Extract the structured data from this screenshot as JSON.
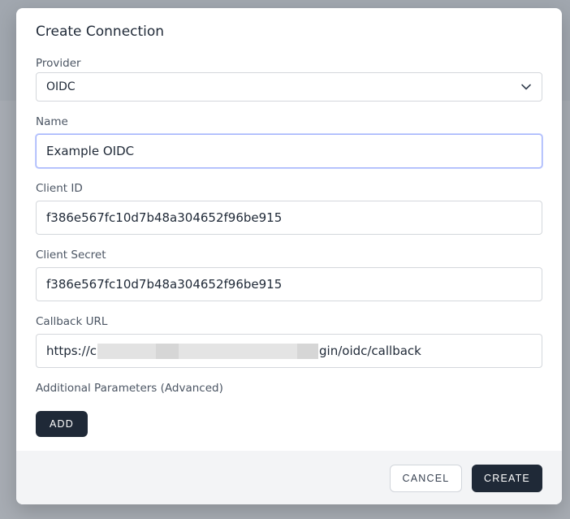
{
  "dialog": {
    "title": "Create Connection"
  },
  "fields": {
    "provider": {
      "label": "Provider",
      "value": "OIDC"
    },
    "name": {
      "label": "Name",
      "value": "Example OIDC"
    },
    "client_id": {
      "label": "Client ID",
      "value": "f386e567fc10d7b48a304652f96be915"
    },
    "client_secret": {
      "label": "Client Secret",
      "value": "f386e567fc10d7b48a304652f96be915"
    },
    "callback_url": {
      "label": "Callback URL",
      "value_prefix": "https://c",
      "value_suffix": "gin/oidc/callback"
    },
    "additional_params": {
      "label": "Additional Parameters (Advanced)"
    }
  },
  "buttons": {
    "add": "ADD",
    "cancel": "CANCEL",
    "create": "CREATE"
  },
  "icons": {
    "provider_dropdown": "chevron-down-icon"
  },
  "colors": {
    "primary_button": "#1f2937",
    "focus_ring": "#a5b4fc",
    "footer_bg": "#f3f4f6"
  }
}
